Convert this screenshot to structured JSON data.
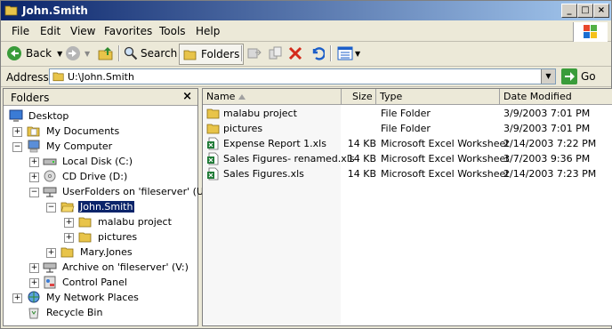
{
  "window": {
    "title": "John.Smith"
  },
  "title_buttons": [
    "_",
    "□",
    "×"
  ],
  "menu": [
    "File",
    "Edit",
    "View",
    "Favorites",
    "Tools",
    "Help"
  ],
  "toolbar": {
    "back_label": "Back",
    "search_label": "Search",
    "folders_label": "Folders"
  },
  "address": {
    "label": "Address",
    "value": "U:\\John.Smith",
    "go_label": "Go"
  },
  "folders_pane": {
    "title": "Folders",
    "tree": [
      {
        "label": "Desktop",
        "icon": "desktop-icon"
      },
      {
        "label": "My Documents",
        "icon": "my-documents-icon"
      },
      {
        "label": "My Computer",
        "icon": "my-computer-icon"
      },
      {
        "label": "Local Disk (C:)",
        "icon": "local-disk-icon"
      },
      {
        "label": "CD Drive (D:)",
        "icon": "cd-drive-icon"
      },
      {
        "label": "UserFolders on 'fileserver' (U:)",
        "icon": "network-drive-icon"
      },
      {
        "label": "John.Smith",
        "icon": "folder-open-icon",
        "selected": true
      },
      {
        "label": "malabu project",
        "icon": "folder-icon"
      },
      {
        "label": "pictures",
        "icon": "folder-icon"
      },
      {
        "label": "Mary.Jones",
        "icon": "folder-icon"
      },
      {
        "label": "Archive on 'fileserver' (V:)",
        "icon": "network-drive-icon"
      },
      {
        "label": "Control Panel",
        "icon": "control-panel-icon"
      },
      {
        "label": "My Network Places",
        "icon": "network-places-icon"
      },
      {
        "label": "Recycle Bin",
        "icon": "recycle-bin-icon"
      }
    ]
  },
  "file_list": {
    "columns": [
      "Name",
      "Size",
      "Type",
      "Date Modified"
    ],
    "rows": [
      {
        "name": "malabu project",
        "size": "",
        "type": "File Folder",
        "date": "3/9/2003 7:01 PM",
        "icon": "folder-icon"
      },
      {
        "name": "pictures",
        "size": "",
        "type": "File Folder",
        "date": "3/9/2003 7:01 PM",
        "icon": "folder-icon"
      },
      {
        "name": "Expense Report 1.xls",
        "size": "14 KB",
        "type": "Microsoft Excel Worksheet",
        "date": "2/14/2003 7:22 PM",
        "icon": "excel-file-icon"
      },
      {
        "name": "Sales Figures- renamed.xls",
        "size": "14 KB",
        "type": "Microsoft Excel Worksheet",
        "date": "3/7/2003 9:36 PM",
        "icon": "excel-file-icon"
      },
      {
        "name": "Sales Figures.xls",
        "size": "14 KB",
        "type": "Microsoft Excel Worksheet",
        "date": "2/14/2003 7:23 PM",
        "icon": "excel-file-icon"
      }
    ]
  }
}
